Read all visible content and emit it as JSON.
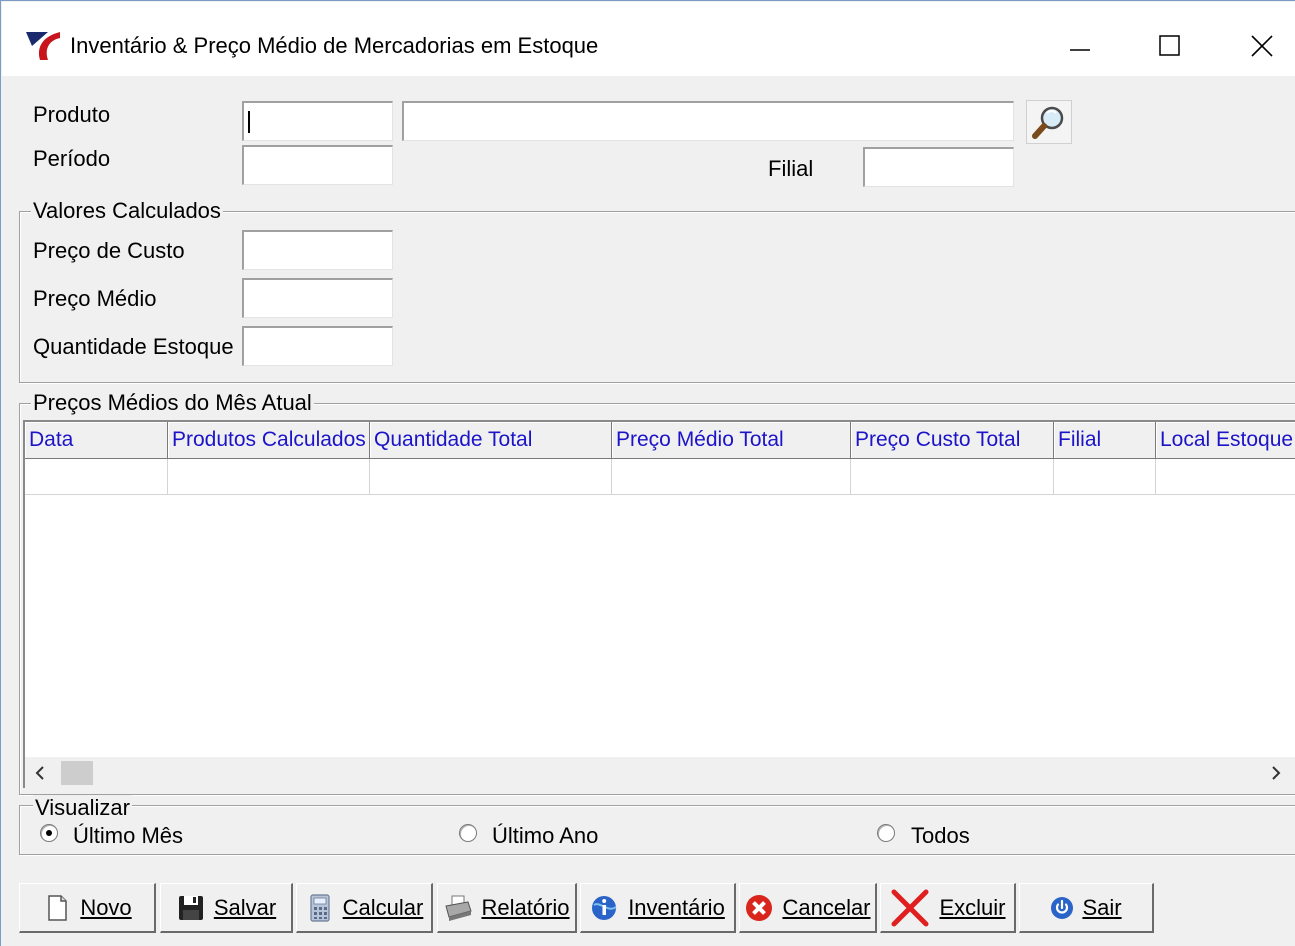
{
  "window": {
    "title": "Inventário & Preço Médio de Mercadorias em Estoque",
    "controls": [
      "minimize-icon",
      "maximize-icon",
      "close-icon"
    ]
  },
  "form": {
    "produto_label": "Produto",
    "produto_code": "",
    "produto_desc": "",
    "periodo_label": "Período",
    "periodo_value": "",
    "filial_label": "Filial",
    "filial_value": ""
  },
  "valores": {
    "group_label": "Valores Calculados",
    "custo_label": "Preço de Custo",
    "custo_value": "",
    "medio_label": "Preço Médio",
    "medio_value": "",
    "qtd_label": "Quantidade Estoque",
    "qtd_value": ""
  },
  "grid": {
    "group_label": "Preços Médios do Mês Atual",
    "columns": [
      "Data",
      "Produtos Calculados",
      "Quantidade Total",
      "Preço Médio Total",
      "Preço Custo Total",
      "Filial",
      "Local Estoque"
    ],
    "rows": [
      [
        "",
        "",
        "",
        "",
        "",
        "",
        ""
      ]
    ]
  },
  "visualizar": {
    "group_label": "Visualizar",
    "options": [
      {
        "label": "Último Mês",
        "selected": true
      },
      {
        "label": "Último Ano",
        "selected": false
      },
      {
        "label": "Todos",
        "selected": false
      }
    ]
  },
  "toolbar": {
    "buttons": [
      {
        "label": "Novo",
        "icon": "new-document-icon"
      },
      {
        "label": "Salvar",
        "icon": "floppy-disk-icon"
      },
      {
        "label": "Calcular",
        "icon": "calculator-icon"
      },
      {
        "label": "Relatório",
        "icon": "printer-icon"
      },
      {
        "label": "Inventário",
        "icon": "info-globe-icon"
      },
      {
        "label": "Cancelar",
        "icon": "cancel-icon"
      },
      {
        "label": "Excluir",
        "icon": "delete-x-icon"
      },
      {
        "label": "Sair",
        "icon": "power-icon"
      }
    ]
  },
  "colors": {
    "column_header_text": "#1c14c8",
    "cancel_red": "#d9261c",
    "excluir_red": "#e02020",
    "sair_blue": "#2a64c8"
  }
}
